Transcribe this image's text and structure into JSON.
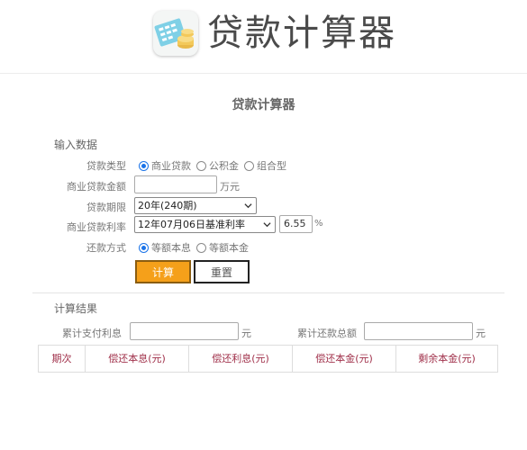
{
  "header": {
    "title": "贷款计算器",
    "logo_icon": "calculator-coins-icon"
  },
  "page_title": "贷款计算器",
  "input_section": {
    "label": "输入数据",
    "loan_type": {
      "label": "贷款类型",
      "options": [
        "商业贷款",
        "公积金",
        "组合型"
      ],
      "selected": "商业贷款"
    },
    "amount": {
      "label": "商业贷款金额",
      "value": "",
      "unit": "万元"
    },
    "term": {
      "label": "贷款期限",
      "selected": "20年(240期)"
    },
    "rate": {
      "label": "商业贷款利率",
      "selected": "12年07月06日基准利率",
      "value": "6.55",
      "unit": "%"
    },
    "repayment": {
      "label": "还款方式",
      "options": [
        "等额本息",
        "等额本金"
      ],
      "selected": "等额本息"
    },
    "buttons": {
      "calculate": "计算",
      "reset": "重置"
    }
  },
  "result_section": {
    "label": "计算结果",
    "total_interest": {
      "label": "累计支付利息",
      "value": "",
      "unit": "元"
    },
    "total_payment": {
      "label": "累计还款总额",
      "value": "",
      "unit": "元"
    },
    "table_headers": [
      "期次",
      "偿还本息(元)",
      "偿还利息(元)",
      "偿还本金(元)",
      "剩余本金(元)"
    ]
  },
  "colors": {
    "accent_button": "#f5a01a",
    "radio_checked": "#1a73e8",
    "table_header_text": "#a0304a"
  }
}
